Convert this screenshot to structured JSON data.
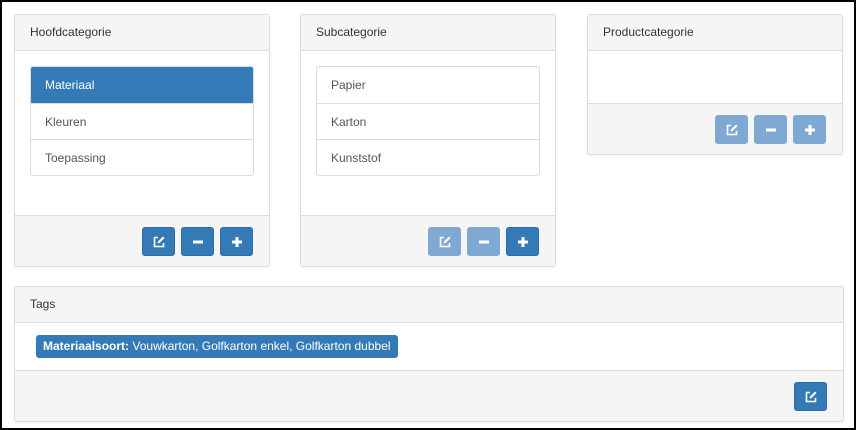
{
  "hoofdcategorie": {
    "title": "Hoofdcategorie",
    "items": [
      {
        "label": "Materiaal",
        "active": true
      },
      {
        "label": "Kleuren",
        "active": false
      },
      {
        "label": "Toepassing",
        "active": false
      }
    ],
    "buttons": {
      "edit": "enabled",
      "remove": "enabled",
      "add": "enabled"
    }
  },
  "subcategorie": {
    "title": "Subcategorie",
    "items": [
      {
        "label": "Papier"
      },
      {
        "label": "Karton"
      },
      {
        "label": "Kunststof"
      }
    ],
    "buttons": {
      "edit": "disabled",
      "remove": "disabled",
      "add": "enabled"
    }
  },
  "productcategorie": {
    "title": "Productcategorie",
    "items": [],
    "buttons": {
      "edit": "disabled",
      "remove": "disabled",
      "add": "disabled"
    }
  },
  "tags": {
    "title": "Tags",
    "tag": {
      "name": "Materiaalsoort:",
      "values": "Vouwkarton, Golfkarton enkel, Golfkarton dubbel"
    }
  },
  "colors": {
    "primary": "#337ab7",
    "primary_disabled": "#7fa9d3"
  },
  "icons": {
    "edit": "edit-icon",
    "remove": "minus-icon",
    "add": "plus-icon"
  }
}
